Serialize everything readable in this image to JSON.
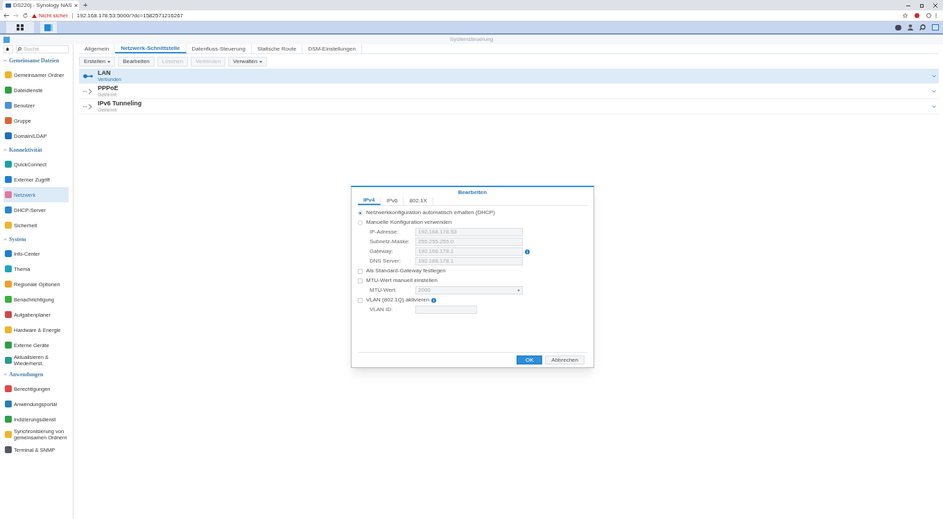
{
  "browser": {
    "tab_title": "DS220j - Synology NAS",
    "tab_close": "×",
    "new_tab": "+",
    "security": "Nicht sicher",
    "url": "192.168.178.53:5000/?dc=1582571216267"
  },
  "window": {
    "title": "Systemsteuerung"
  },
  "search": {
    "placeholder": "Suche"
  },
  "sidebar": {
    "sections": [
      {
        "title": "Gemeinsame Dateien",
        "expanded": true,
        "items": [
          {
            "label": "Gemeinsamer Ordner",
            "selected": false
          },
          {
            "label": "Dateidienste",
            "selected": false
          },
          {
            "label": "Benutzer",
            "selected": false
          },
          {
            "label": "Gruppe",
            "selected": false
          },
          {
            "label": "Domain/LDAP",
            "selected": false
          }
        ]
      },
      {
        "title": "Konnektivität",
        "expanded": true,
        "items": [
          {
            "label": "QuickConnect",
            "selected": false
          },
          {
            "label": "Externer Zugriff",
            "selected": false
          },
          {
            "label": "Netzwerk",
            "selected": true
          },
          {
            "label": "DHCP-Server",
            "selected": false
          },
          {
            "label": "Sicherheit",
            "selected": false
          }
        ]
      },
      {
        "title": "System",
        "expanded": true,
        "items": [
          {
            "label": "Info-Center",
            "selected": false
          },
          {
            "label": "Thema",
            "selected": false
          },
          {
            "label": "Regionale Optionen",
            "selected": false
          },
          {
            "label": "Benachrichtigung",
            "selected": false
          },
          {
            "label": "Aufgabenplaner",
            "selected": false
          },
          {
            "label": "Hardware & Energie",
            "selected": false
          },
          {
            "label": "Externe Geräte",
            "selected": false
          },
          {
            "label": "Aktualisieren & Wiederherst.",
            "selected": false
          }
        ]
      },
      {
        "title": "Anwendungen",
        "expanded": true,
        "items": [
          {
            "label": "Berechtigungen",
            "selected": false
          },
          {
            "label": "Anwendungsportal",
            "selected": false
          },
          {
            "label": "Indizierungsdienst",
            "selected": false
          },
          {
            "label": "Synchronisierung von gemeinsamen Ordnern",
            "selected": false
          },
          {
            "label": "Terminal & SNMP",
            "selected": false
          }
        ]
      }
    ]
  },
  "tabs": [
    {
      "label": "Allgemein",
      "selected": false
    },
    {
      "label": "Netzwerk-Schnittstelle",
      "selected": true
    },
    {
      "label": "Datenfluss-Steuerung",
      "selected": false
    },
    {
      "label": "Statische Route",
      "selected": false
    },
    {
      "label": "DSM-Einstellungen",
      "selected": false
    }
  ],
  "toolbar": [
    {
      "label": "Erstellen",
      "dropdown": true,
      "disabled": false
    },
    {
      "label": "Bearbeiten",
      "dropdown": false,
      "disabled": false
    },
    {
      "label": "Löschen",
      "dropdown": false,
      "disabled": true
    },
    {
      "label": "Verbinden",
      "dropdown": false,
      "disabled": true
    },
    {
      "label": "Verwalten",
      "dropdown": true,
      "disabled": false
    }
  ],
  "interfaces": [
    {
      "name": "LAN",
      "status": "Verbunden",
      "connected": true,
      "selected": true
    },
    {
      "name": "PPPoE",
      "status": "Getrennt",
      "connected": false,
      "selected": false
    },
    {
      "name": "IPv6 Tunneling",
      "status": "Getrennt",
      "connected": false,
      "selected": false
    }
  ],
  "dialog": {
    "title": "Bearbeiten",
    "tabs": [
      {
        "label": "IPv4",
        "selected": true
      },
      {
        "label": "IPv6",
        "selected": false
      },
      {
        "label": "802.1X",
        "selected": false
      }
    ],
    "rows": [
      {
        "kind": "radio",
        "label": "Netzwerkkonfiguration automatisch erhalten (DHCP)",
        "selected": true
      },
      {
        "kind": "radio",
        "label": "Manuelle Konfiguration verwenden",
        "selected": false
      },
      {
        "kind": "field",
        "label": "IP-Adresse:",
        "value": "192.168.178.53",
        "disabled": true,
        "info": false
      },
      {
        "kind": "field",
        "label": "Subnetz-Maske:",
        "value": "255.255.255.0",
        "disabled": true,
        "info": false
      },
      {
        "kind": "field",
        "label": "Gateway:",
        "value": "192.168.178.1",
        "disabled": true,
        "info": true
      },
      {
        "kind": "field",
        "label": "DNS Server:",
        "value": "192.168.178.1",
        "disabled": true,
        "info": false
      },
      {
        "kind": "checkbox",
        "label": "Als Standard-Gateway festlegen",
        "checked": false,
        "info": false
      },
      {
        "kind": "checkbox",
        "label": "MTU-Wert manuell einstellen",
        "checked": false,
        "info": false
      },
      {
        "kind": "select",
        "label": "MTU-Wert:",
        "value": "2000",
        "disabled": true
      },
      {
        "kind": "checkbox",
        "label": "VLAN (802.1Q) aktivieren",
        "checked": false,
        "info": true
      },
      {
        "kind": "short_field",
        "label": "VLAN ID:",
        "disabled": true
      }
    ],
    "buttons": [
      {
        "label": "OK",
        "primary": true
      },
      {
        "label": "Abbrechen",
        "primary": false
      }
    ]
  }
}
